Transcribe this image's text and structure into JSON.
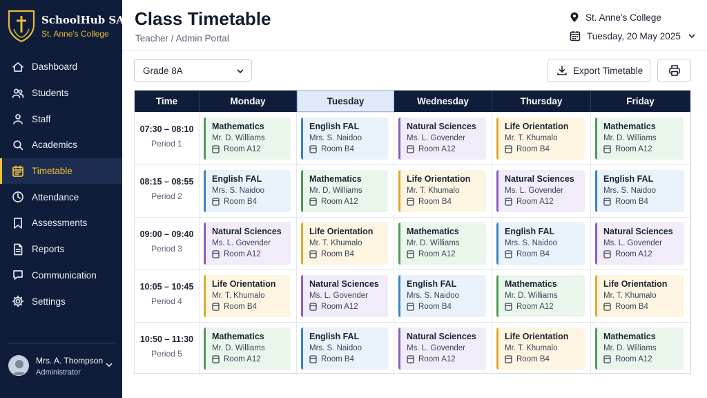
{
  "brand": {
    "name": "SchoolHub SA",
    "school": "St. Anne's College"
  },
  "nav": [
    {
      "label": "Dashboard",
      "icon": "home-icon"
    },
    {
      "label": "Students",
      "icon": "students-icon"
    },
    {
      "label": "Staff",
      "icon": "staff-icon"
    },
    {
      "label": "Academics",
      "icon": "academics-icon"
    },
    {
      "label": "Timetable",
      "icon": "calendar-icon",
      "active": true
    },
    {
      "label": "Attendance",
      "icon": "clock-icon"
    },
    {
      "label": "Assessments",
      "icon": "bookmark-icon"
    },
    {
      "label": "Reports",
      "icon": "document-icon"
    },
    {
      "label": "Communication",
      "icon": "chat-icon"
    },
    {
      "label": "Settings",
      "icon": "gear-icon"
    }
  ],
  "user": {
    "name": "Mrs. A. Thompson",
    "role": "Administrator"
  },
  "header": {
    "title": "Class Timetable",
    "subtitle": "Teacher / Admin Portal",
    "school": "St. Anne's College",
    "date": "Tuesday, 20 May 2025"
  },
  "toolbar": {
    "grade": "Grade 8A",
    "export_label": "Export Timetable"
  },
  "timetable": {
    "time_header": "Time",
    "days": [
      "Monday",
      "Tuesday",
      "Wednesday",
      "Thursday",
      "Friday"
    ],
    "today": "Tuesday",
    "periods": [
      {
        "time": "07:30 – 08:10",
        "label": "Period 1"
      },
      {
        "time": "08:15 – 08:55",
        "label": "Period 2"
      },
      {
        "time": "09:00 – 09:40",
        "label": "Period 3"
      },
      {
        "time": "10:05 – 10:45",
        "label": "Period 4"
      },
      {
        "time": "10:50 – 11:30",
        "label": "Period 5"
      }
    ],
    "grid": [
      [
        {
          "subject": "Mathematics",
          "teacher": "Mr. D. Williams",
          "room": "Room A12"
        },
        {
          "subject": "English FAL",
          "teacher": "Mrs. S. Naidoo",
          "room": "Room B4"
        },
        {
          "subject": "Natural Sciences",
          "teacher": "Ms. L. Govender",
          "room": "Room A12"
        },
        {
          "subject": "Life Orientation",
          "teacher": "Mr. T. Khumalo",
          "room": "Room B4"
        },
        {
          "subject": "Mathematics",
          "teacher": "Mr. D. Williams",
          "room": "Room A12"
        }
      ],
      [
        {
          "subject": "English FAL",
          "teacher": "Mrs. S. Naidoo",
          "room": "Room B4"
        },
        {
          "subject": "Mathematics",
          "teacher": "Mr. D. Williams",
          "room": "Room A12"
        },
        {
          "subject": "Life Orientation",
          "teacher": "Mr. T. Khumalo",
          "room": "Room B4"
        },
        {
          "subject": "Natural Sciences",
          "teacher": "Ms. L. Govender",
          "room": "Room A12"
        },
        {
          "subject": "English FAL",
          "teacher": "Mrs. S. Naidoo",
          "room": "Room B4"
        }
      ],
      [
        {
          "subject": "Natural Sciences",
          "teacher": "Ms. L. Govender",
          "room": "Room A12"
        },
        {
          "subject": "Life Orientation",
          "teacher": "Mr. T. Khumalo",
          "room": "Room B4"
        },
        {
          "subject": "Mathematics",
          "teacher": "Mr. D. Williams",
          "room": "Room A12"
        },
        {
          "subject": "English FAL",
          "teacher": "Mrs. S. Naidoo",
          "room": "Room B4"
        },
        {
          "subject": "Natural Sciences",
          "teacher": "Ms. L. Govender",
          "room": "Room A12"
        }
      ],
      [
        {
          "subject": "Life Orientation",
          "teacher": "Mr. T. Khumalo",
          "room": "Room B4"
        },
        {
          "subject": "Natural Sciences",
          "teacher": "Ms. L. Govender",
          "room": "Room A12"
        },
        {
          "subject": "English FAL",
          "teacher": "Mrs. S. Naidoo",
          "room": "Room B4"
        },
        {
          "subject": "Mathematics",
          "teacher": "Mr. D. Williams",
          "room": "Room A12"
        },
        {
          "subject": "Life Orientation",
          "teacher": "Mr. T. Khumalo",
          "room": "Room B4"
        }
      ],
      [
        {
          "subject": "Mathematics",
          "teacher": "Mr. D. Williams",
          "room": "Room A12"
        },
        {
          "subject": "English FAL",
          "teacher": "Mrs. S. Naidoo",
          "room": "Room B4"
        },
        {
          "subject": "Natural Sciences",
          "teacher": "Ms. L. Govender",
          "room": "Room A12"
        },
        {
          "subject": "Life Orientation",
          "teacher": "Mr. T. Khumalo",
          "room": "Room B4"
        },
        {
          "subject": "Mathematics",
          "teacher": "Mr. D. Williams",
          "room": "Room A12"
        }
      ]
    ]
  },
  "subject_colors": {
    "Mathematics": {
      "border": "#4f9a5b",
      "bg": "#eaf5ec"
    },
    "English FAL": {
      "border": "#3b82c4",
      "bg": "#e9f1fb"
    },
    "Natural Sciences": {
      "border": "#8a5cc4",
      "bg": "#f1ebfa"
    },
    "Life Orientation": {
      "border": "#e0a82e",
      "bg": "#fdf5e1"
    }
  },
  "colors": {
    "sidebar": "#0f1d3a",
    "accent": "#f2c233",
    "today_header": "#dfe9f7"
  }
}
